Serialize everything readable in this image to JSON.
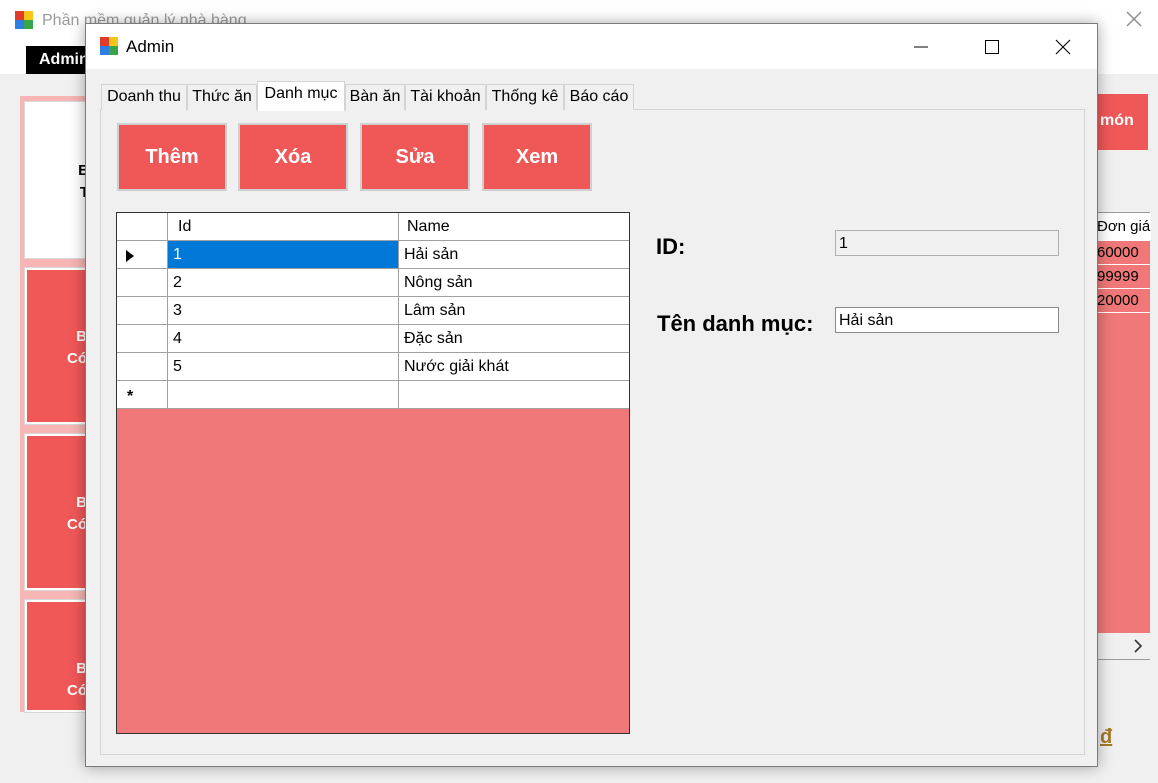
{
  "background_window": {
    "title": "Phần mềm quản lý nhà hàng",
    "admin_menu": "Admin",
    "table_buttons": [
      {
        "line1": "B",
        "line2": "T"
      },
      {
        "line1": "B",
        "line2": "Có"
      },
      {
        "line1": "B",
        "line2": "Có"
      },
      {
        "line1": "B",
        "line2": "Có"
      }
    ],
    "add_dish_button": "món",
    "order_grid": {
      "header": "Đơn giá",
      "values": [
        "60000",
        "99999",
        "20000"
      ]
    },
    "currency_symbol": "đ"
  },
  "dialog": {
    "title": "Admin",
    "tabs": [
      "Doanh thu",
      "Thức ăn",
      "Danh mục",
      "Bàn ăn",
      "Tài khoản",
      "Thống kê",
      "Báo cáo"
    ],
    "active_tab": "Danh mục",
    "actions": {
      "add": "Thêm",
      "delete": "Xóa",
      "edit": "Sửa",
      "view": "Xem"
    },
    "grid": {
      "columns": [
        "Id",
        "Name"
      ],
      "rows": [
        {
          "id": "1",
          "name": "Hải sản"
        },
        {
          "id": "2",
          "name": "Nông sản"
        },
        {
          "id": "3",
          "name": "Lâm sản"
        },
        {
          "id": "4",
          "name": "Đặc sản"
        },
        {
          "id": "5",
          "name": "Nước giải khát"
        }
      ],
      "new_row_marker": "*"
    },
    "form": {
      "id_label": "ID:",
      "id_value": "1",
      "name_label": "Tên danh mục:",
      "name_value": "Hải sản"
    }
  },
  "colors": {
    "accent_red": "#f05858",
    "grid_background": "#f07878",
    "selection_blue": "#0078d7"
  },
  "icons": [
    "app-icon",
    "minimize-icon",
    "maximize-icon",
    "close-icon",
    "row-selector-icon",
    "scroll-right-icon"
  ]
}
